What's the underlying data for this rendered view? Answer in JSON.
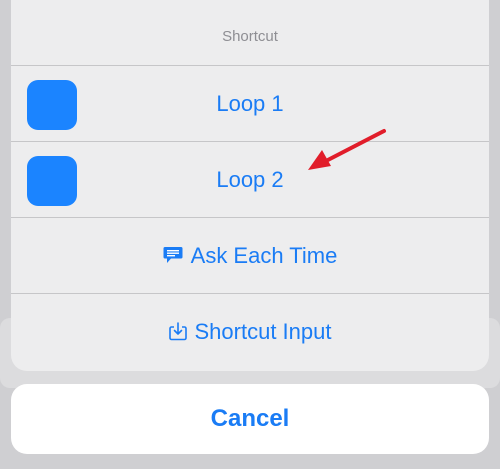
{
  "sheet": {
    "title": "Shortcut",
    "options": [
      {
        "label": "Loop 1",
        "icon": "shortcut-tile"
      },
      {
        "label": "Loop 2",
        "icon": "shortcut-tile"
      },
      {
        "label": "Ask Each Time",
        "icon": "chat-bubble-icon"
      },
      {
        "label": "Shortcut Input",
        "icon": "tray-arrow-icon"
      }
    ]
  },
  "cancel_label": "Cancel",
  "colors": {
    "accent": "#1a7cf5",
    "tile": "#1b84ff",
    "annotation_arrow": "#e11d2a"
  }
}
